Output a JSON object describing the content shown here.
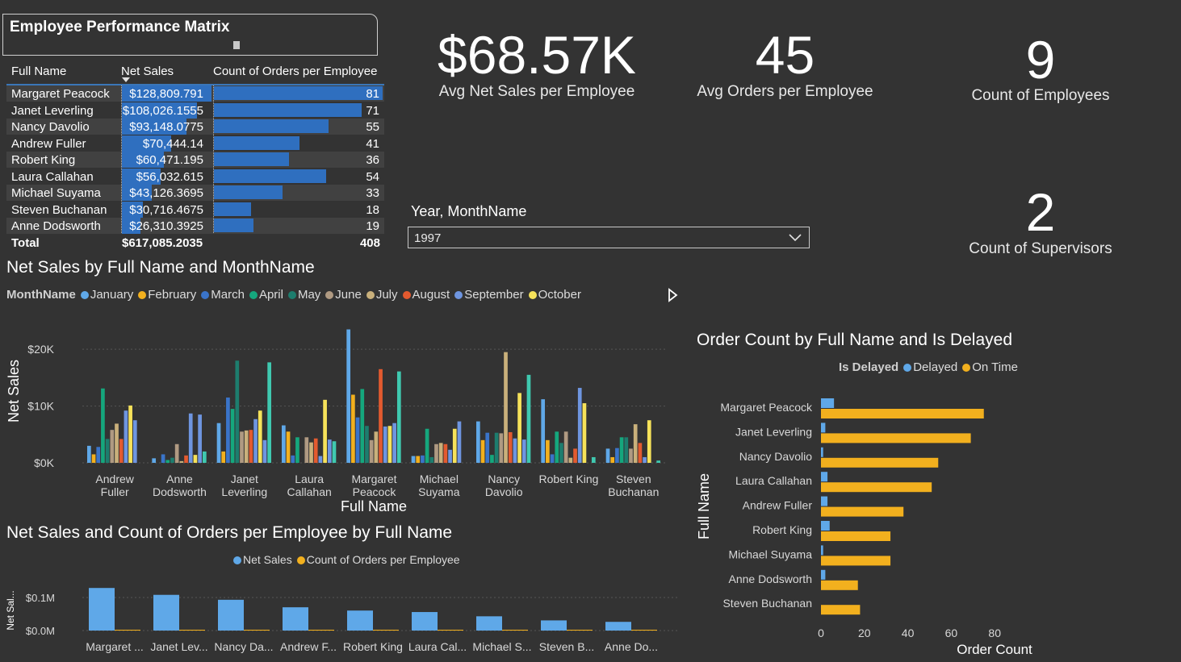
{
  "matrix": {
    "title": "Employee Performance Matrix",
    "headers": {
      "name": "Full Name",
      "sales": "Net Sales",
      "orders": "Count of Orders per Employee"
    },
    "rows": [
      {
        "name": "Margaret Peacock",
        "sales": "$128,809.791",
        "sales_value": 128809.791,
        "orders": "81",
        "orders_value": 81
      },
      {
        "name": "Janet Leverling",
        "sales": "$108,026.1555",
        "sales_value": 108026.1555,
        "orders": "71",
        "orders_value": 71
      },
      {
        "name": "Nancy Davolio",
        "sales": "$93,148.0775",
        "sales_value": 93148.0775,
        "orders": "55",
        "orders_value": 55
      },
      {
        "name": "Andrew Fuller",
        "sales": "$70,444.14",
        "sales_value": 70444.14,
        "orders": "41",
        "orders_value": 41
      },
      {
        "name": "Robert King",
        "sales": "$60,471.195",
        "sales_value": 60471.195,
        "orders": "36",
        "orders_value": 36
      },
      {
        "name": "Laura Callahan",
        "sales": "$56,032.615",
        "sales_value": 56032.615,
        "orders": "54",
        "orders_value": 54
      },
      {
        "name": "Michael Suyama",
        "sales": "$43,126.3695",
        "sales_value": 43126.3695,
        "orders": "33",
        "orders_value": 33
      },
      {
        "name": "Steven Buchanan",
        "sales": "$30,716.4675",
        "sales_value": 30716.4675,
        "orders": "18",
        "orders_value": 18
      },
      {
        "name": "Anne Dodsworth",
        "sales": "$26,310.3925",
        "sales_value": 26310.3925,
        "orders": "19",
        "orders_value": 19
      }
    ],
    "total": {
      "label": "Total",
      "sales": "$617,085.2035",
      "orders": "408"
    }
  },
  "kpis": {
    "avg_sales": {
      "value": "$68.57K",
      "label": "Avg Net Sales per Employee"
    },
    "avg_orders": {
      "value": "45",
      "label": "Avg Orders per Employee"
    },
    "employees": {
      "value": "9",
      "label": "Count of Employees"
    },
    "supervisors": {
      "value": "2",
      "label": "Count of Supervisors"
    }
  },
  "slicer": {
    "label": "Year, MonthName",
    "value": "1997"
  },
  "colors": {
    "accent": "#2f6fbf",
    "January": "#5fa8e8",
    "February": "#f2b01e",
    "March": "#3a74c9",
    "April": "#15a77d",
    "May": "#1d7d6e",
    "June": "#b09a82",
    "July": "#c9b07b",
    "August": "#e35a2f",
    "September": "#6e95e0",
    "October": "#f6e25a",
    "Delayed": "#5fa8e8",
    "OnTime": "#f2b01e",
    "NetSales": "#5fa8e8",
    "Orders": "#f2b01e"
  },
  "chart_data": [
    {
      "type": "bar",
      "title": "Net Sales by Full Name and MonthName",
      "xlabel": "Full Name",
      "ylabel": "Net Sales",
      "legend_title": "MonthName",
      "ylim": [
        0,
        24000
      ],
      "yticks": [
        "$0K",
        "$10K",
        "$20K"
      ],
      "categories": [
        "Andrew Fuller",
        "Anne Dodsworth",
        "Janet Leverling",
        "Laura Callahan",
        "Margaret Peacock",
        "Michael Suyama",
        "Nancy Davolio",
        "Robert King",
        "Steven Buchanan"
      ],
      "series": [
        {
          "name": "January",
          "values": [
            3000,
            800,
            7000,
            6600,
            23500,
            1200,
            7300,
            11200,
            2500
          ]
        },
        {
          "name": "February",
          "values": [
            1500,
            0,
            2000,
            5500,
            12000,
            1200,
            4000,
            4000,
            1000
          ]
        },
        {
          "name": "March",
          "values": [
            2800,
            1500,
            11500,
            1300,
            8000,
            1300,
            5300,
            1500,
            2600
          ]
        },
        {
          "name": "April",
          "values": [
            13100,
            500,
            9500,
            4500,
            13000,
            6000,
            1400,
            5500,
            4500
          ]
        },
        {
          "name": "May",
          "values": [
            4200,
            900,
            18000,
            0,
            6500,
            1000,
            5300,
            3500,
            4500
          ]
        },
        {
          "name": "June",
          "values": [
            5800,
            3300,
            5500,
            4500,
            4000,
            3300,
            5200,
            5500,
            2500
          ]
        },
        {
          "name": "July",
          "values": [
            6900,
            300,
            5700,
            3600,
            5500,
            3500,
            19500,
            900,
            6800
          ]
        },
        {
          "name": "August",
          "values": [
            4200,
            1300,
            5800,
            4300,
            16500,
            3300,
            5400,
            2500,
            3500
          ]
        },
        {
          "name": "September",
          "values": [
            9200,
            8700,
            7700,
            1200,
            6400,
            2300,
            4300,
            13200,
            1000
          ]
        },
        {
          "name": "October",
          "values": [
            10100,
            1400,
            9200,
            11100,
            6500,
            6000,
            12300,
            10500,
            7500
          ]
        },
        {
          "name": "",
          "values": [
            7500,
            8500,
            4000,
            4100,
            7000,
            7300,
            4100,
            0,
            0
          ]
        },
        {
          "name": "",
          "values": [
            0,
            2000,
            17700,
            3800,
            16100,
            0,
            15500,
            1000,
            400
          ]
        }
      ]
    },
    {
      "type": "bar",
      "orientation": "horizontal",
      "title": "Order Count by Full Name and Is Delayed",
      "xlabel": "Order Count",
      "ylabel": "Full Name",
      "legend_title": "Is Delayed",
      "xlim": [
        0,
        80
      ],
      "xticks": [
        0,
        20,
        40,
        60,
        80
      ],
      "categories": [
        "Margaret Peacock",
        "Janet Leverling",
        "Nancy Davolio",
        "Laura Callahan",
        "Andrew Fuller",
        "Robert King",
        "Michael Suyama",
        "Anne Dodsworth",
        "Steven Buchanan"
      ],
      "series": [
        {
          "name": "Delayed",
          "values": [
            6,
            2,
            1,
            3,
            3,
            4,
            1,
            2,
            0
          ]
        },
        {
          "name": "On Time",
          "values": [
            75,
            69,
            54,
            51,
            38,
            32,
            32,
            17,
            18
          ]
        }
      ]
    },
    {
      "type": "bar",
      "title": "Net Sales and Count of Orders per Employee by Full Name",
      "ylabel": "Net Sal...",
      "yticks": [
        "$0.0M",
        "$0.1M"
      ],
      "ylim": [
        0,
        0.14
      ],
      "categories": [
        "Margaret ...",
        "Janet Lev...",
        "Nancy Da...",
        "Andrew F...",
        "Robert King",
        "Laura Cal...",
        "Michael S...",
        "Steven B...",
        "Anne Do..."
      ],
      "series": [
        {
          "name": "Net Sales",
          "values": [
            0.1288,
            0.108,
            0.0931,
            0.0704,
            0.0605,
            0.056,
            0.0431,
            0.0307,
            0.0263
          ]
        },
        {
          "name": "Count of Orders per Employee",
          "values": [
            81,
            71,
            55,
            41,
            36,
            54,
            33,
            18,
            19
          ]
        }
      ]
    }
  ]
}
